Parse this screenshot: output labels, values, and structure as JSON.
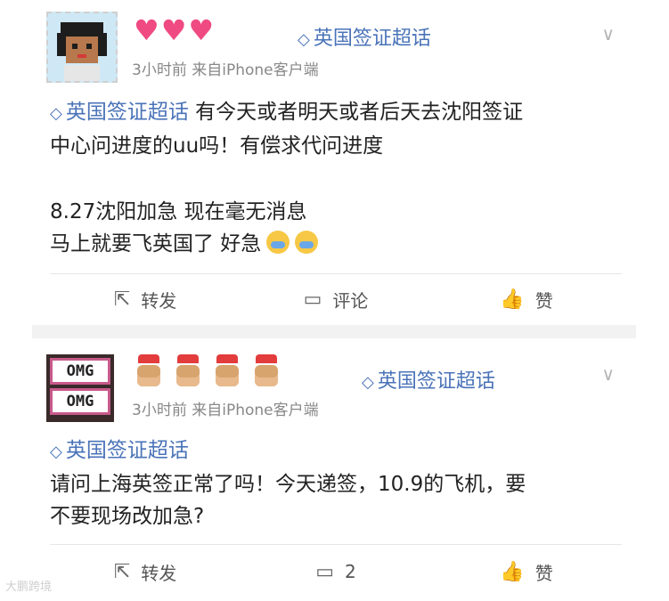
{
  "posts": [
    {
      "avatar": "pixel-portrait",
      "badges": "♥♥♥",
      "topic": "英国签证超话",
      "meta": "3小时前  来自iPhone客户端",
      "inline_topic": "英国签证超话",
      "lines_a": [
        "有今天或者明天或者后天去沈阳签证",
        "中心问进度的uu吗！有偿求代问进度"
      ],
      "lines_b": [
        "8.27沈阳加急 现在毫无消息",
        "马上就要飞英国了 好急"
      ],
      "actions": {
        "repost": "转发",
        "comment": "评论",
        "like": "赞"
      }
    },
    {
      "avatar_text": [
        "OMG",
        "OMG"
      ],
      "topic": "英国签证超话",
      "meta": "3小时前  来自iPhone客户端",
      "inline_topic": "英国签证超话",
      "lines_a": [
        "请问上海英签正常了吗！今天递签，10.9的飞机，要",
        "不要现场改加急?"
      ],
      "actions": {
        "repost": "转发",
        "comment": "2",
        "like": "赞"
      }
    }
  ],
  "icons": {
    "topic": "diamond-icon",
    "chevron": "chevron-down-icon",
    "repost": "repost-icon",
    "comment": "comment-icon",
    "like": "thumb-up-icon"
  },
  "colors": {
    "topic": "#4a73b8",
    "heart": "#f04a82"
  },
  "watermark": "大鹏跨境"
}
